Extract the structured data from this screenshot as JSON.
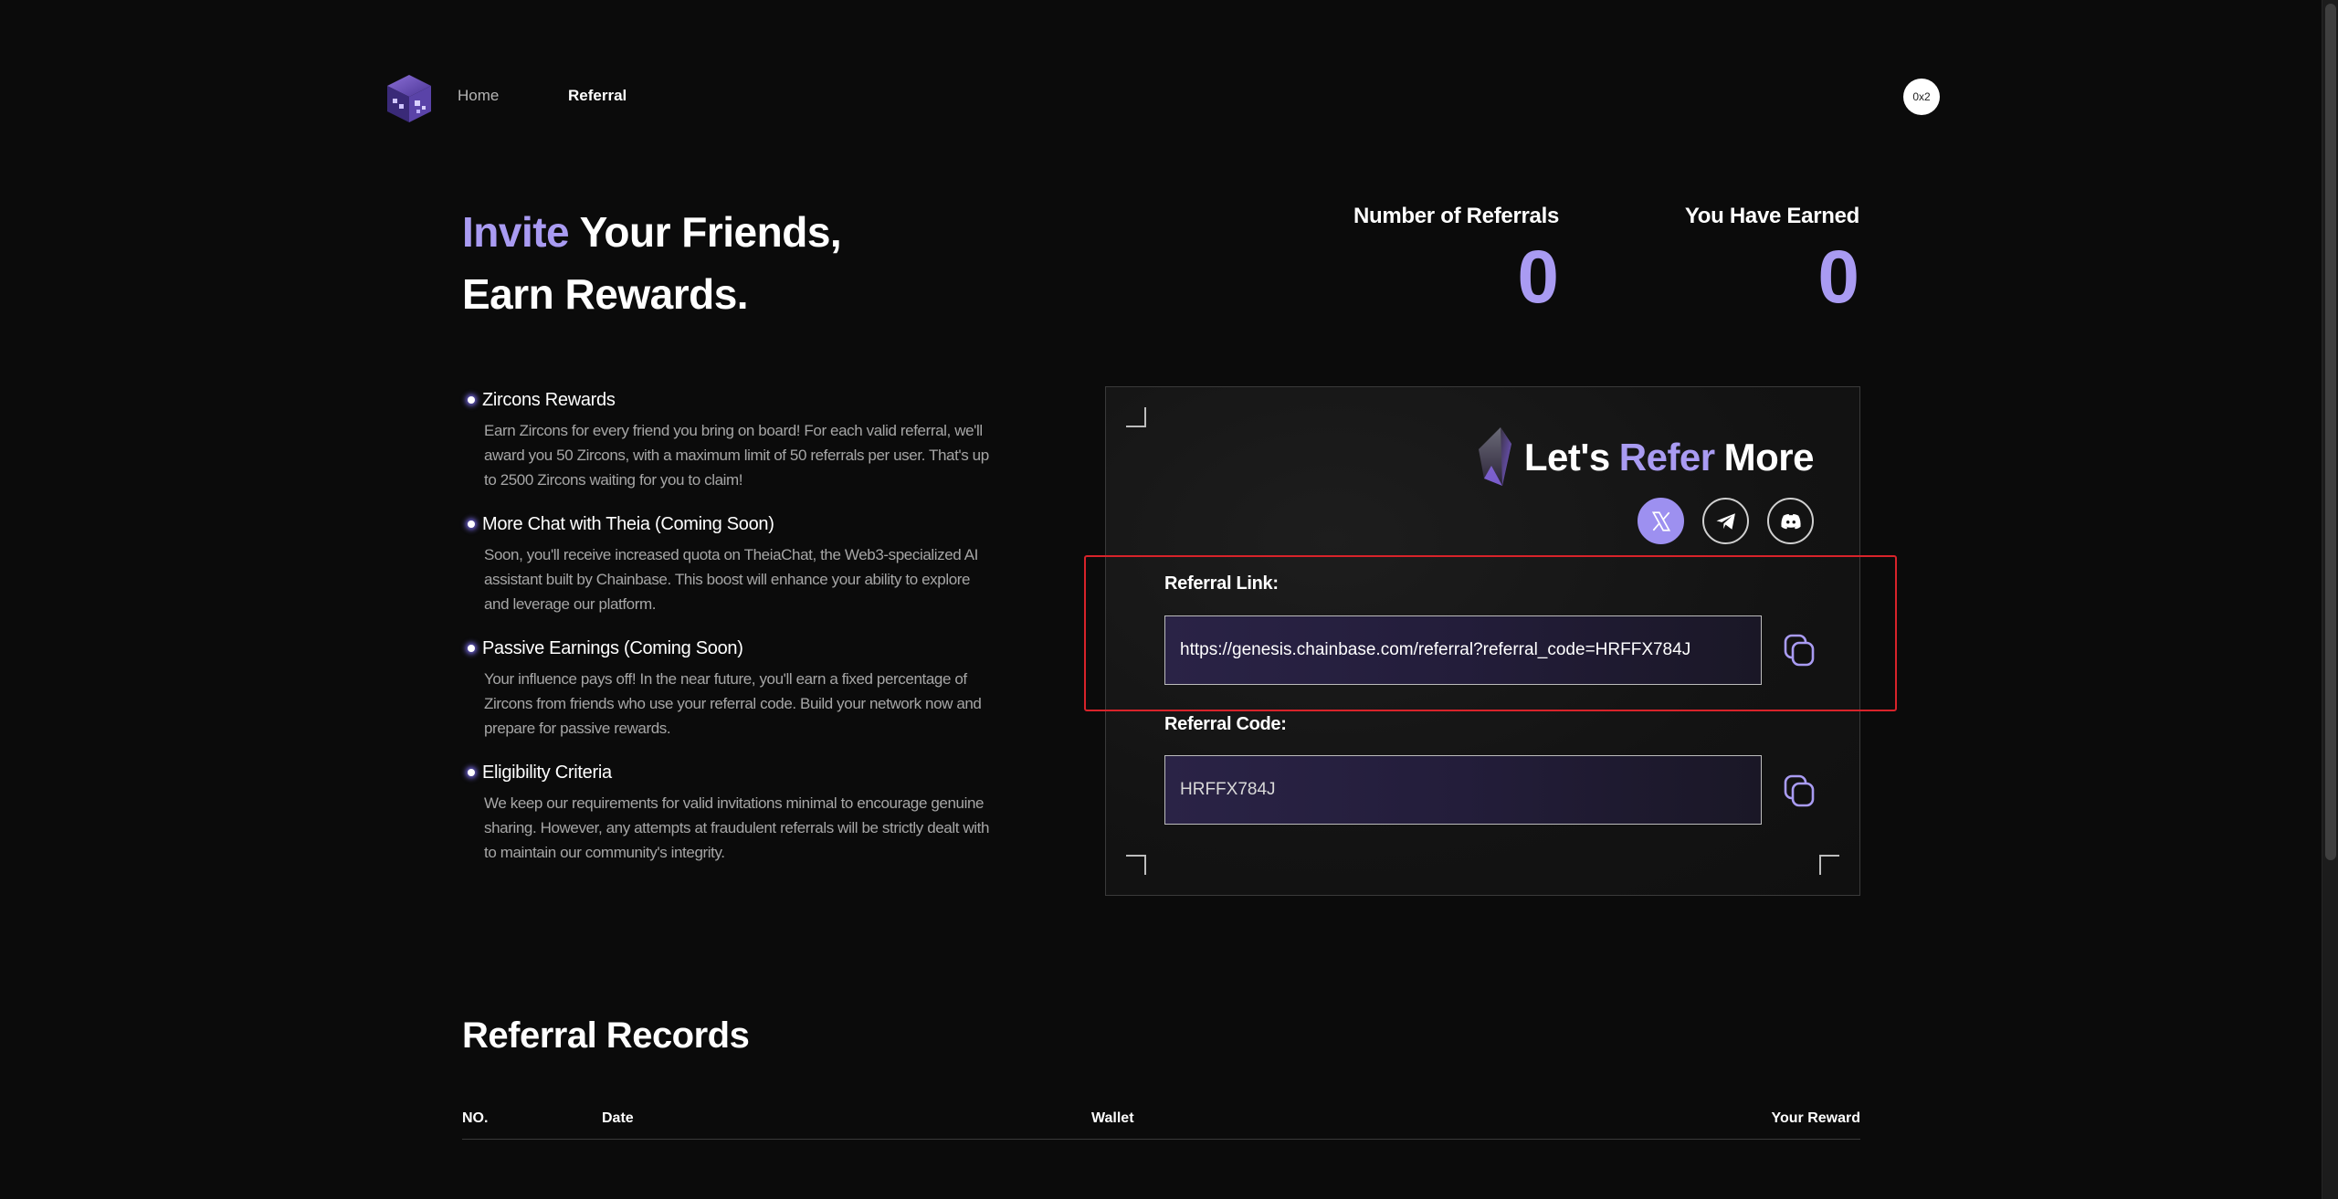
{
  "nav": {
    "home": "Home",
    "referral": "Referral",
    "account": "0x2"
  },
  "hero": {
    "headline_accent": "Invite",
    "headline_line1": " Your Friends,",
    "headline_line2": "Earn Rewards."
  },
  "stats": {
    "referrals_label": "Number of Referrals",
    "referrals_value": "0",
    "earned_label": "You Have Earned",
    "earned_value": "0"
  },
  "features": [
    {
      "title": "Zircons Rewards",
      "desc": "Earn Zircons for every friend you bring on board! For each valid referral, we'll award you 50 Zircons, with a maximum limit of 50 referrals per user. That's up to 2500 Zircons waiting for you to claim!"
    },
    {
      "title": "More Chat with Theia (Coming Soon)",
      "desc": "Soon, you'll receive increased quota on TheiaChat, the Web3-specialized AI assistant built by Chainbase. This boost will enhance your ability to explore and leverage our platform."
    },
    {
      "title": "Passive Earnings (Coming Soon)",
      "desc": "Your influence pays off! In the near future, you'll earn a fixed percentage of Zircons from friends who use your referral code. Build your network now and prepare for passive rewards."
    },
    {
      "title": "Eligibility Criteria",
      "desc": "We keep our requirements for valid invitations minimal to encourage genuine sharing. However, any attempts at fraudulent referrals will be strictly dealt with to maintain our community's integrity."
    }
  ],
  "card": {
    "title_pre": "Let's",
    "title_accent": "Refer",
    "title_post": "More",
    "link_label": "Referral Link:",
    "link_value": "https://genesis.chainbase.com/referral?referral_code=HRFFX784J",
    "code_label": "Referral Code:",
    "code_value": "HRFFX784J"
  },
  "records": {
    "title": "Referral Records",
    "columns": [
      "NO.",
      "Date",
      "Wallet",
      "Your Reward"
    ]
  },
  "colors": {
    "accent": "#a99bf2",
    "background": "#0b0b0b",
    "highlight": "#d8232a"
  },
  "icons": [
    "logo-cube-icon",
    "crystal-icon",
    "x-icon",
    "telegram-icon",
    "discord-icon",
    "copy-icon"
  ]
}
